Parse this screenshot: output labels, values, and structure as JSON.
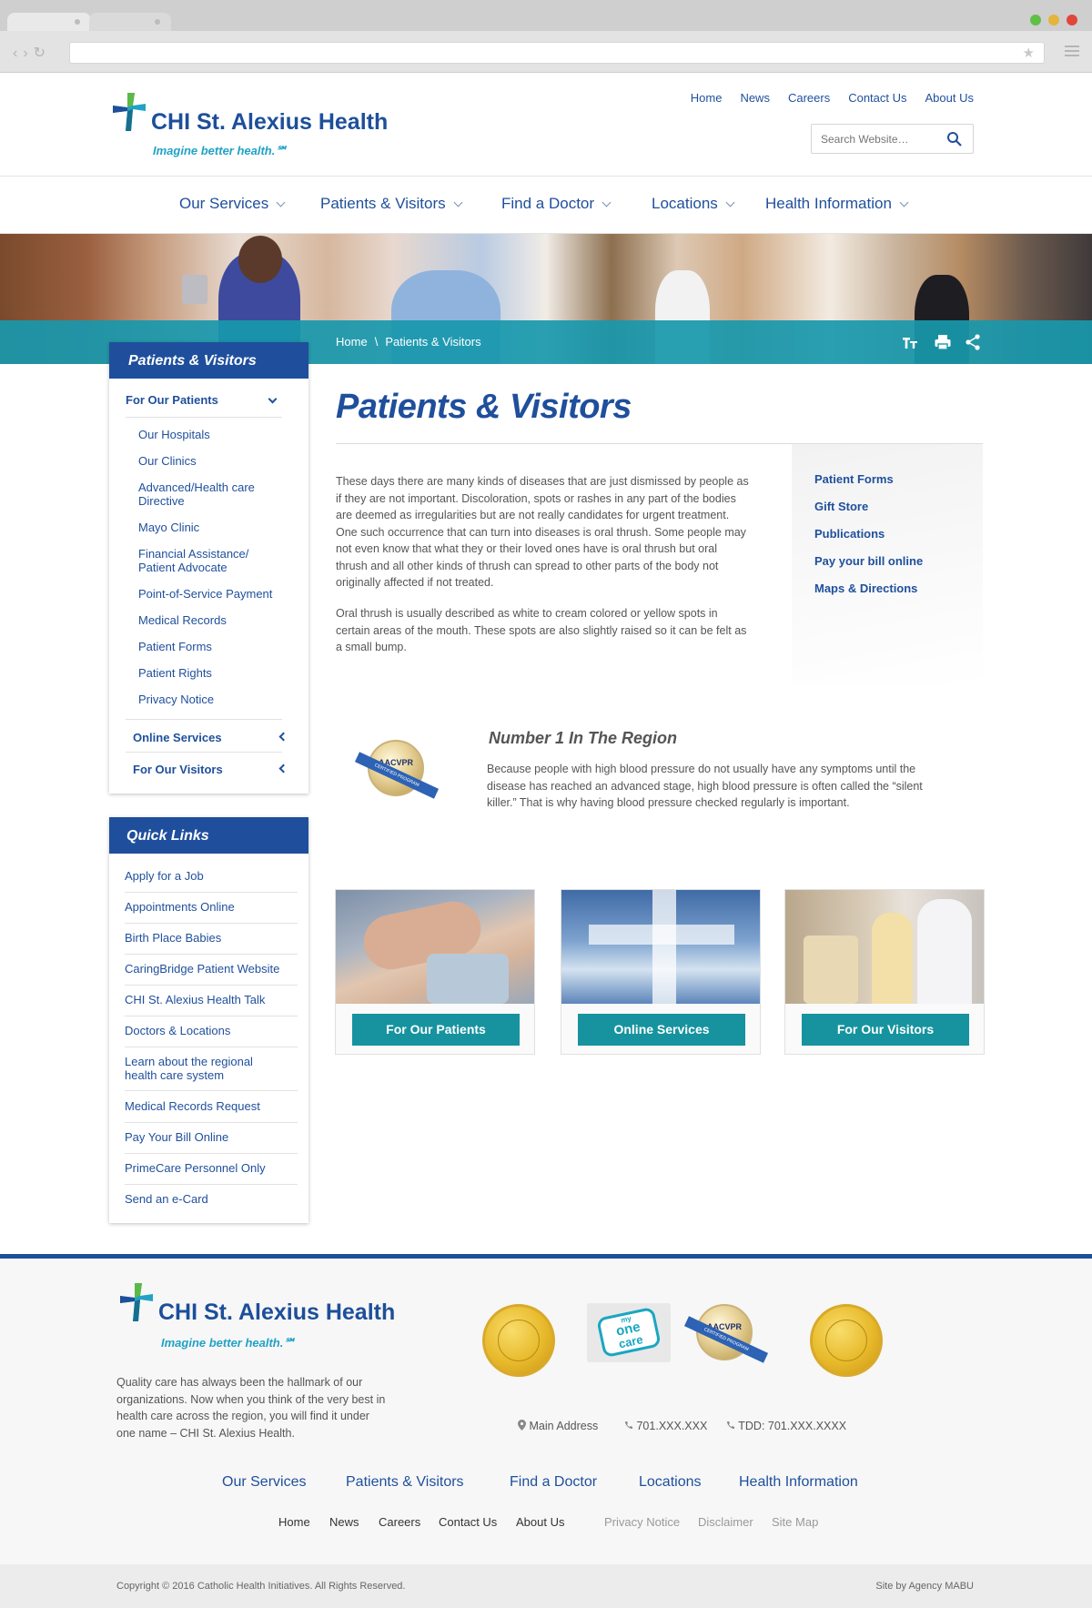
{
  "site": {
    "name": "CHI St. Alexius Health",
    "tagline": "Imagine better health.℠"
  },
  "utility_nav": [
    "Home",
    "News",
    "Careers",
    "Contact Us",
    "About Us"
  ],
  "search": {
    "placeholder": "Search Website…"
  },
  "main_nav": [
    "Our Services",
    "Patients & Visitors",
    "Find a Doctor",
    "Locations",
    "Health Information"
  ],
  "breadcrumb": {
    "home": "Home",
    "separator": "\\",
    "current": "Patients & Visitors"
  },
  "toolbar_icons": [
    "text-size-icon",
    "print-icon",
    "share-icon"
  ],
  "sidebar": {
    "title": "Patients & Visitors",
    "section": "For Our Patients",
    "links": [
      "Our Hospitals",
      "Our Clinics",
      "Advanced/Health care Directive",
      "Mayo Clinic",
      "Financial Assistance/ Patient Advocate",
      "Point-of-Service Payment",
      "Medical Records",
      "Patient Forms",
      "Patient Rights",
      "Privacy Notice"
    ],
    "collapsed_sections": [
      "Online Services",
      "For Our Visitors"
    ]
  },
  "quick_links": {
    "title": "Quick Links",
    "items": [
      "Apply for a Job",
      "Appointments Online",
      "Birth Place Babies",
      "CaringBridge Patient Website",
      "CHI St. Alexius Health Talk",
      "Doctors & Locations",
      "Learn about the regional health care system",
      "Medical Records Request",
      "Pay Your Bill Online",
      "PrimeCare Personnel Only",
      "Send an e-Card"
    ]
  },
  "page": {
    "title": "Patients & Visitors",
    "paragraphs": [
      "These days there are many kinds of diseases that are just dismissed by people as if they are not important. Discoloration, spots or rashes in any part of the bodies are deemed as irregularities but are not really candidates for urgent treatment. One such occurrence that can turn into diseases is oral thrush. Some people may not even know that what they or their loved ones have is oral thrush but oral thrush and all other kinds of thrush can spread to other parts of the body not originally affected if not treated.",
      "Oral thrush is usually described as white to cream colored or yellow spots in certain areas of the mouth. These spots are also slightly raised so it can be felt as a small bump."
    ],
    "related_links": [
      "Patient Forms",
      "Gift Store",
      "Publications",
      "Pay your bill online",
      "Maps & Directions"
    ],
    "badge": {
      "title": "Number 1 In The Region",
      "text": "Because people with high blood pressure do not usually have any symptoms until the disease has reached an advanced stage, high blood pressure is often called the “silent killer.” That is why having blood pressure checked regularly is important.",
      "seal_text": "AACVPR",
      "ribbon_text": "CERTIFIED PROGRAM"
    },
    "cards": [
      "For Our Patients",
      "Online Services",
      "For Our Visitors"
    ]
  },
  "footer": {
    "description": "Quality care has always been the hallmark of our organizations.  Now when you think of the very best in health care across the region, you will find it under one name – CHI St. Alexius Health.",
    "address": "Main Address",
    "phone": "701.XXX.XXX",
    "tdd": "TDD: 701.XXX.XXXX",
    "nav": [
      "Our Services",
      "Patients & Visitors",
      "Find a Doctor",
      "Locations",
      "Health Information"
    ],
    "util_links": [
      "Home",
      "News",
      "Careers",
      "Contact Us",
      "About Us"
    ],
    "legal_links": [
      "Privacy Notice",
      "Disclaimer",
      "Site Map"
    ],
    "onecare_text": [
      "my",
      "one",
      "care"
    ],
    "copyright": "Copyright © 2016 Catholic Health Initiatives. All Rights Reserved.",
    "credit": "Site by Agency MABU"
  },
  "colors": {
    "brand_blue": "#1f4f9c",
    "teal": "#16939f",
    "tagline_teal": "#21a2c7",
    "traffic_green": "#5fbf47",
    "traffic_yellow": "#e5b53b",
    "traffic_red": "#e0463c"
  }
}
